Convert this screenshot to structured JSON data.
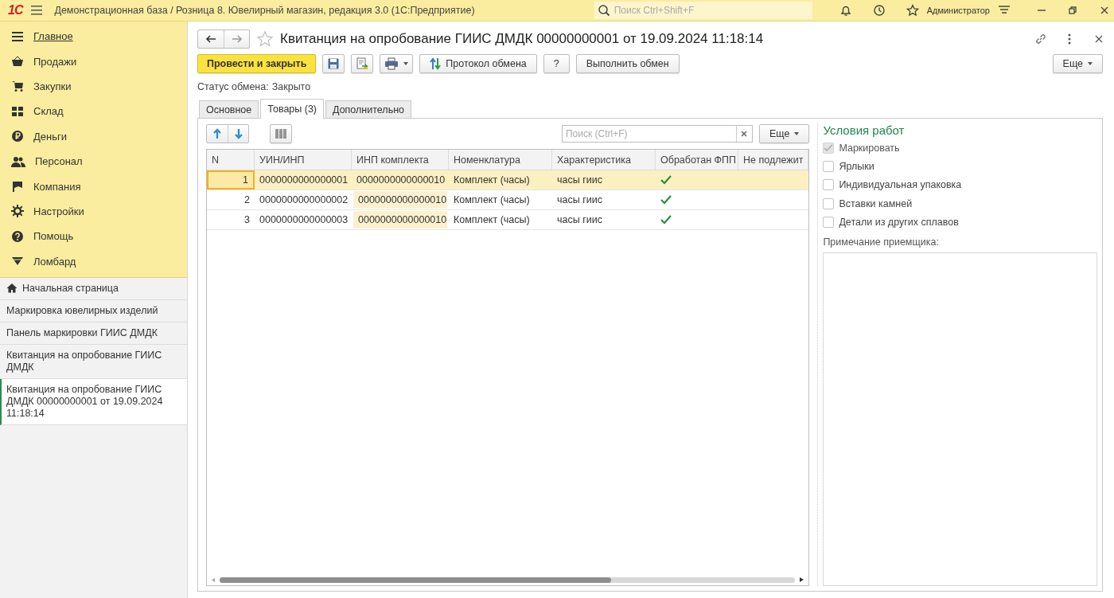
{
  "topbar": {
    "logo": "1С",
    "app_title": "Демонстрационная база / Розница 8. Ювелирный магазин, редакция 3.0  (1С:Предприятие)",
    "search": {
      "placeholder": "Поиск Ctrl+Shift+F"
    },
    "user": "Администратор"
  },
  "sections": [
    {
      "kind": "main",
      "label": "Главное",
      "selected": true
    },
    {
      "kind": "sales",
      "label": "Продажи",
      "selected": false
    },
    {
      "kind": "purchases",
      "label": "Закупки",
      "selected": false
    },
    {
      "kind": "warehouse",
      "label": "Склад",
      "selected": false
    },
    {
      "kind": "money",
      "label": "Деньги",
      "selected": false
    },
    {
      "kind": "staff",
      "label": "Персонал",
      "selected": false
    },
    {
      "kind": "company",
      "label": "Компания",
      "selected": false
    },
    {
      "kind": "settings",
      "label": "Настройки",
      "selected": false
    },
    {
      "kind": "help",
      "label": "Помощь",
      "selected": false
    },
    {
      "kind": "pawnshop",
      "label": "Ломбард",
      "selected": false
    }
  ],
  "open_windows": [
    {
      "kind": "home",
      "label": "Начальная страница",
      "selected": false
    },
    {
      "kind": "page",
      "label": "Маркировка ювелирных изделий",
      "selected": false
    },
    {
      "kind": "page",
      "label": "Панель маркировки ГИИС ДМДК",
      "selected": false
    },
    {
      "kind": "page",
      "label": "Квитанция на опробование ГИИС ДМДК",
      "selected": false
    },
    {
      "kind": "page",
      "label": "Квитанция на опробование ГИИС ДМДК 00000000001 от 19.09.2024 11:18:14",
      "selected": true
    }
  ],
  "form": {
    "title": "Квитанция на опробование ГИИС ДМДК 00000000001 от 19.09.2024 11:18:14",
    "commands": [
      {
        "kind": "primary",
        "label": "Провести и закрыть"
      },
      {
        "kind": "save"
      },
      {
        "kind": "report"
      },
      {
        "kind": "print"
      },
      {
        "kind": "exchange",
        "label": "Протокол обмена"
      },
      {
        "kind": "text",
        "label": "?"
      },
      {
        "kind": "text",
        "label": "Выполнить обмен"
      }
    ],
    "more": "Еще",
    "status_label": "Статус обмена:",
    "status_value": "Закрыто",
    "tabs": [
      {
        "label": "Основное",
        "selected": false
      },
      {
        "label": "Товары (3)",
        "selected": true
      },
      {
        "label": "Дополнительно",
        "selected": false
      }
    ],
    "table_search": {
      "placeholder": "Поиск (Ctrl+F)"
    },
    "table_more": "Еще",
    "table": {
      "columns": [
        "N",
        "УИН/ИНП",
        "ИНП комплекта",
        "Номенклатура",
        "Характеристика",
        "Обработан ФПП",
        "Не подлежит"
      ],
      "rows": [
        {
          "n": "1",
          "uin": "0000000000000001",
          "set_inp": "0000000000000010",
          "item": "Комплект (часы)",
          "feature": "часы гиис",
          "processed": true,
          "selected": true
        },
        {
          "n": "2",
          "uin": "0000000000000002",
          "set_inp": "0000000000000010",
          "item": "Комплект (часы)",
          "feature": "часы гиис",
          "processed": true,
          "selected": false
        },
        {
          "n": "3",
          "uin": "0000000000000003",
          "set_inp": "0000000000000010",
          "item": "Комплект (часы)",
          "feature": "часы гиис",
          "processed": true,
          "selected": false
        }
      ]
    },
    "conditions": {
      "title": "Условия работ",
      "options": [
        {
          "label": "Маркировать",
          "checked": true,
          "disabled": true
        },
        {
          "label": "Ярлыки",
          "checked": false,
          "disabled": false
        },
        {
          "label": "Индивидуальная упаковка",
          "checked": false,
          "disabled": false
        },
        {
          "label": "Вставки камней",
          "checked": false,
          "disabled": false
        },
        {
          "label": "Детали из других сплавов",
          "checked": false,
          "disabled": false
        }
      ],
      "note_label": "Примечание приемщика:"
    }
  }
}
